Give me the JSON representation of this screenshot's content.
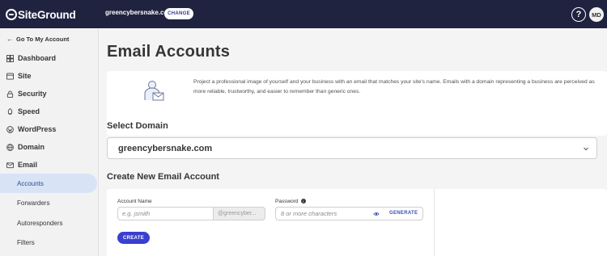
{
  "topbar": {
    "logo_text": "SiteGround",
    "domain": "greencybersnake.com",
    "change_label": "CHANGE",
    "help_icon": "?",
    "avatar_initials": "MD"
  },
  "sidebar": {
    "back_label": "Go To My Account",
    "items": [
      {
        "label": "Dashboard",
        "icon": "dashboard-icon"
      },
      {
        "label": "Site",
        "icon": "site-icon"
      },
      {
        "label": "Security",
        "icon": "lock-icon"
      },
      {
        "label": "Speed",
        "icon": "rocket-icon"
      },
      {
        "label": "WordPress",
        "icon": "wordpress-icon"
      },
      {
        "label": "Domain",
        "icon": "globe-icon"
      },
      {
        "label": "Email",
        "icon": "envelope-icon"
      }
    ],
    "subitems": [
      {
        "label": "Accounts",
        "active": true
      },
      {
        "label": "Forwarders",
        "active": false
      },
      {
        "label": "Autoresponders",
        "active": false
      },
      {
        "label": "Filters",
        "active": false
      }
    ]
  },
  "main": {
    "title": "Email Accounts",
    "intro": "Project a professional image of yourself and your business with an email that matches your site's name. Emails with a domain representing a business are perceived as more reliable, trustworthy, and easier to remember than generic ones.",
    "select_domain_heading": "Select Domain",
    "selected_domain": "greencybersnake.com",
    "create_heading": "Create New Email Account",
    "form": {
      "account_name_label": "Account Name",
      "account_name_placeholder": "e.g. jsmith",
      "account_suffix": "@greencyber...",
      "password_label": "Password",
      "password_placeholder": "8 or more characters",
      "generate_label": "GENERATE",
      "create_label": "CREATE"
    }
  },
  "colors": {
    "topbar_bg": "#1f2340",
    "accent": "#3a3fcf",
    "active_nav_bg": "#d8e4f6"
  }
}
